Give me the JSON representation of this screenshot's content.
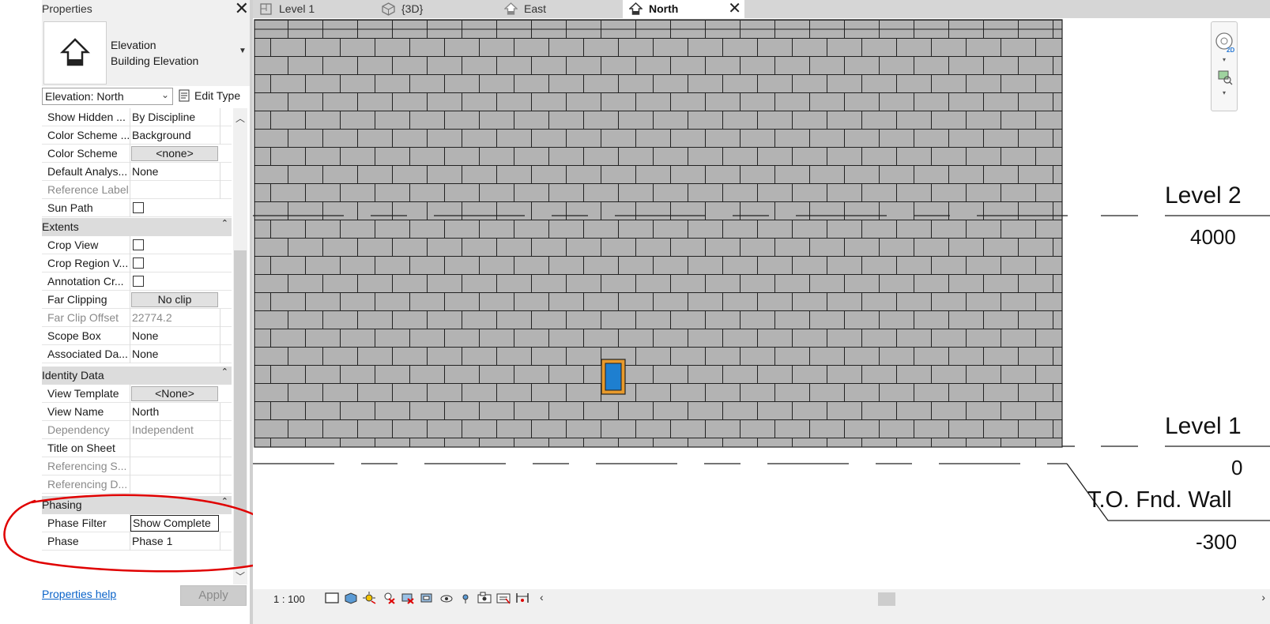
{
  "properties_panel": {
    "title": "Properties",
    "type_family": "Elevation",
    "type_name": "Building Elevation",
    "view_selector": "Elevation: North",
    "edit_type_label": "Edit Type",
    "rows": [
      {
        "label": "Show Hidden ...",
        "value": "By Discipline"
      },
      {
        "label": "Color Scheme ...",
        "value": "Background"
      },
      {
        "label": "Color Scheme",
        "value": "<none>"
      },
      {
        "label": "Default Analys...",
        "value": "None"
      },
      {
        "label": "Reference Label",
        "value": ""
      },
      {
        "label": "Sun Path",
        "value": ""
      }
    ],
    "extents": {
      "title": "Extents",
      "rows": [
        {
          "label": "Crop View",
          "value": ""
        },
        {
          "label": "Crop Region V...",
          "value": ""
        },
        {
          "label": "Annotation Cr...",
          "value": ""
        },
        {
          "label": "Far Clipping",
          "value": "No clip"
        },
        {
          "label": "Far Clip Offset",
          "value": "22774.2"
        },
        {
          "label": "Scope Box",
          "value": "None"
        },
        {
          "label": "Associated Da...",
          "value": "None"
        }
      ]
    },
    "identity": {
      "title": "Identity Data",
      "rows": [
        {
          "label": "View Template",
          "value": "<None>"
        },
        {
          "label": "View Name",
          "value": "North"
        },
        {
          "label": "Dependency",
          "value": "Independent"
        },
        {
          "label": "Title on Sheet",
          "value": ""
        },
        {
          "label": "Referencing S...",
          "value": ""
        },
        {
          "label": "Referencing D...",
          "value": ""
        }
      ]
    },
    "phasing": {
      "title": "Phasing",
      "rows": [
        {
          "label": "Phase Filter",
          "value": "Show Complete"
        },
        {
          "label": "Phase",
          "value": "Phase 1"
        }
      ]
    },
    "help_link": "Properties help",
    "apply_label": "Apply"
  },
  "tabs": [
    {
      "label": "Level 1",
      "icon": "floor-plan-icon",
      "active": false
    },
    {
      "label": "{3D}",
      "icon": "3d-view-icon",
      "active": false
    },
    {
      "label": "East",
      "icon": "elevation-icon",
      "active": false
    },
    {
      "label": "North",
      "icon": "elevation-icon",
      "active": true
    }
  ],
  "canvas": {
    "levels": [
      {
        "name": "Level 2",
        "value": "4000"
      },
      {
        "name": "Level 1",
        "value": "0"
      },
      {
        "name": "T.O. Fnd. Wall",
        "value": "-300"
      }
    ],
    "colors": {
      "brick_fill": "#b3b3b3",
      "mortar": "#222222",
      "window_glass": "#1e7fd0",
      "window_frame": "#e89a2c",
      "markup": "#e00000"
    }
  },
  "view_control": {
    "scale": "1 : 100"
  }
}
